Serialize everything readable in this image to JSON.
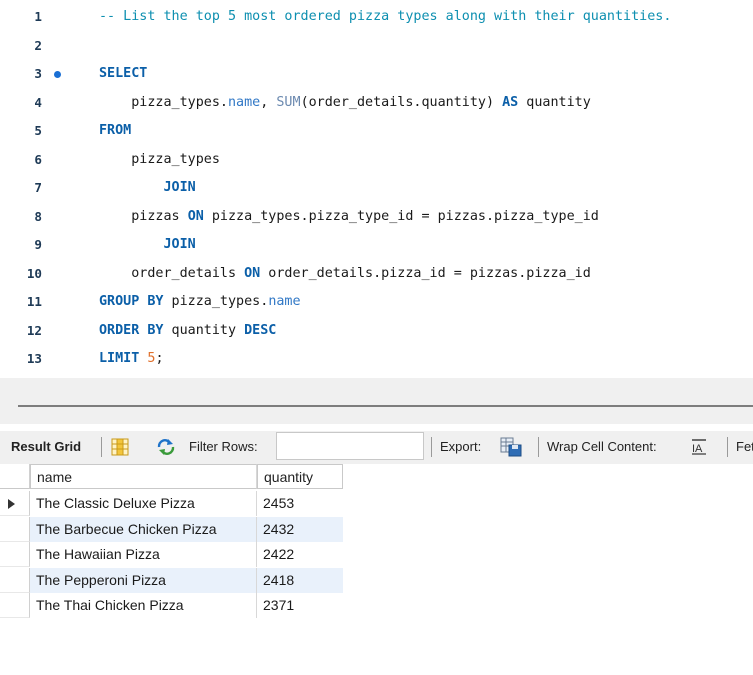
{
  "editor": {
    "lines": [
      {
        "n": "1",
        "tokens": [
          {
            "t": "cm",
            "v": "-- List the top 5 most ordered pizza types along with their quantities."
          }
        ]
      },
      {
        "n": "2",
        "tokens": []
      },
      {
        "n": "3",
        "tokens": [
          {
            "t": "kw",
            "v": "SELECT"
          }
        ],
        "marker": true
      },
      {
        "n": "4",
        "tokens": [
          {
            "t": "p",
            "v": "    pizza_types."
          },
          {
            "t": "ident",
            "v": "name"
          },
          {
            "t": "p",
            "v": ", "
          },
          {
            "t": "fn",
            "v": "SUM"
          },
          {
            "t": "p",
            "v": "(order_details.quantity) "
          },
          {
            "t": "kw",
            "v": "AS"
          },
          {
            "t": "p",
            "v": " quantity"
          }
        ]
      },
      {
        "n": "5",
        "tokens": [
          {
            "t": "kw",
            "v": "FROM"
          }
        ]
      },
      {
        "n": "6",
        "tokens": [
          {
            "t": "p",
            "v": "    pizza_types"
          }
        ]
      },
      {
        "n": "7",
        "tokens": [
          {
            "t": "p",
            "v": "        "
          },
          {
            "t": "kw",
            "v": "JOIN"
          }
        ]
      },
      {
        "n": "8",
        "tokens": [
          {
            "t": "p",
            "v": "    pizzas "
          },
          {
            "t": "kw",
            "v": "ON"
          },
          {
            "t": "p",
            "v": " pizza_types.pizza_type_id = pizzas.pizza_type_id"
          }
        ]
      },
      {
        "n": "9",
        "tokens": [
          {
            "t": "p",
            "v": "        "
          },
          {
            "t": "kw",
            "v": "JOIN"
          }
        ]
      },
      {
        "n": "10",
        "tokens": [
          {
            "t": "p",
            "v": "    order_details "
          },
          {
            "t": "kw",
            "v": "ON"
          },
          {
            "t": "p",
            "v": " order_details.pizza_id = pizzas.pizza_id"
          }
        ]
      },
      {
        "n": "11",
        "tokens": [
          {
            "t": "kw",
            "v": "GROUP BY"
          },
          {
            "t": "p",
            "v": " pizza_types."
          },
          {
            "t": "ident",
            "v": "name"
          }
        ]
      },
      {
        "n": "12",
        "tokens": [
          {
            "t": "kw",
            "v": "ORDER BY"
          },
          {
            "t": "p",
            "v": " quantity "
          },
          {
            "t": "kw",
            "v": "DESC"
          }
        ]
      },
      {
        "n": "13",
        "tokens": [
          {
            "t": "kw",
            "v": "LIMIT"
          },
          {
            "t": "p",
            "v": " "
          },
          {
            "t": "num",
            "v": "5"
          },
          {
            "t": "p",
            "v": ";"
          }
        ]
      }
    ]
  },
  "toolbar": {
    "result_grid_label": "Result Grid",
    "filter_rows_label": "Filter Rows:",
    "filter_value": "",
    "export_label": "Export:",
    "wrap_label": "Wrap Cell Content:",
    "fetch_label": "Fet"
  },
  "grid": {
    "columns": [
      "name",
      "quantity"
    ],
    "rows": [
      [
        "The Classic Deluxe Pizza",
        "2453"
      ],
      [
        "The Barbecue Chicken Pizza",
        "2432"
      ],
      [
        "The Hawaiian Pizza",
        "2422"
      ],
      [
        "The Pepperoni Pizza",
        "2418"
      ],
      [
        "The Thai Chicken Pizza",
        "2371"
      ]
    ]
  },
  "colors": {
    "keyword": "#0b5fa8",
    "comment": "#0d8fb0",
    "number": "#e0702c",
    "alt_row": "#e9f1fb"
  }
}
